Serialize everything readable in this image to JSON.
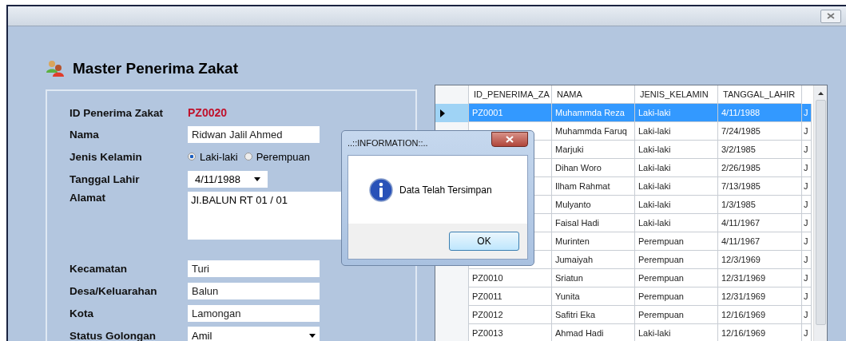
{
  "form": {
    "title": "Master Penerima Zakat",
    "id": {
      "label": "ID Penerima Zakat",
      "value": "PZ0020"
    },
    "nama": {
      "label": "Nama",
      "value": "Ridwan Jalil Ahmed"
    },
    "jenis_kelamin": {
      "label": "Jenis Kelamin",
      "options": [
        {
          "label": "Laki-laki",
          "selected": true
        },
        {
          "label": "Perempuan",
          "selected": false
        }
      ]
    },
    "tanggal_lahir": {
      "label": "Tanggal Lahir",
      "value": "4/11/1988"
    },
    "alamat": {
      "label": "Alamat",
      "value": "JI.BALUN RT 01 / 01"
    },
    "kecamatan": {
      "label": "Kecamatan",
      "value": "Turi"
    },
    "desa": {
      "label": "Desa/Keluarahan",
      "value": "Balun"
    },
    "kota": {
      "label": "Kota",
      "value": "Lamongan"
    },
    "status_golongan": {
      "label": "Status Golongan",
      "value": "Amil"
    }
  },
  "table": {
    "columns": [
      "ID_PENERIMA_ZA",
      "NAMA",
      "JENIS_KELAMIN",
      "TANGGAL_LAHIR"
    ],
    "rows": [
      {
        "selected": true,
        "id": "PZ0001",
        "nama": "Muhammda Reza",
        "jenis_kelamin": "Laki-laki",
        "tanggal_lahir": "4/11/1988",
        "column_5": "J"
      },
      {
        "selected": false,
        "nama": "Muhammda Faruq",
        "jenis_kelamin": "Laki-laki",
        "tanggal_lahir": "7/24/1985",
        "column_5": "J"
      },
      {
        "selected": false,
        "nama": "Marjuki",
        "jenis_kelamin": "Laki-laki",
        "tanggal_lahir": "3/2/1985",
        "column_5": "J"
      },
      {
        "selected": false,
        "nama": "Dihan Woro",
        "jenis_kelamin": "Laki-laki",
        "tanggal_lahir": "2/26/1985",
        "column_5": "J"
      },
      {
        "selected": false,
        "nama": "Ilham Rahmat",
        "jenis_kelamin": "Laki-laki",
        "tanggal_lahir": "7/13/1985",
        "column_5": "J"
      },
      {
        "selected": false,
        "nama": "Mulyanto",
        "jenis_kelamin": "Laki-laki",
        "tanggal_lahir": "1/3/1985",
        "column_5": "J"
      },
      {
        "selected": false,
        "nama": "Faisal Hadi",
        "jenis_kelamin": "Laki-laki",
        "tanggal_lahir": "4/11/1967",
        "column_5": "J"
      },
      {
        "selected": false,
        "nama": "Murinten",
        "jenis_kelamin": "Perempuan",
        "tanggal_lahir": "4/11/1967",
        "column_5": "J"
      },
      {
        "selected": false,
        "nama": "Jumaiyah",
        "jenis_kelamin": "Perempuan",
        "tanggal_lahir": "12/3/1969",
        "column_5": "J"
      },
      {
        "selected": false,
        "id": "PZ0010",
        "nama": "Sriatun",
        "jenis_kelamin": "Perempuan",
        "tanggal_lahir": "12/31/1969",
        "column_5": "J"
      },
      {
        "selected": false,
        "id": "PZ0011",
        "nama": "Yunita",
        "jenis_kelamin": "Perempuan",
        "tanggal_lahir": "12/31/1969",
        "column_5": "J"
      },
      {
        "selected": false,
        "id": "PZ0012",
        "nama": "Safitri Eka",
        "jenis_kelamin": "Perempuan",
        "tanggal_lahir": "12/16/1969",
        "column_5": "J"
      },
      {
        "selected": false,
        "id": "PZ0013",
        "nama": "Ahmad Hadi",
        "jenis_kelamin": "Laki-laki",
        "tanggal_lahir": "12/16/1969",
        "column_5": "J"
      }
    ]
  },
  "dialog": {
    "title": "..::INFORMATION::..",
    "message": "Data Telah Tersimpan",
    "button": "OK"
  }
}
